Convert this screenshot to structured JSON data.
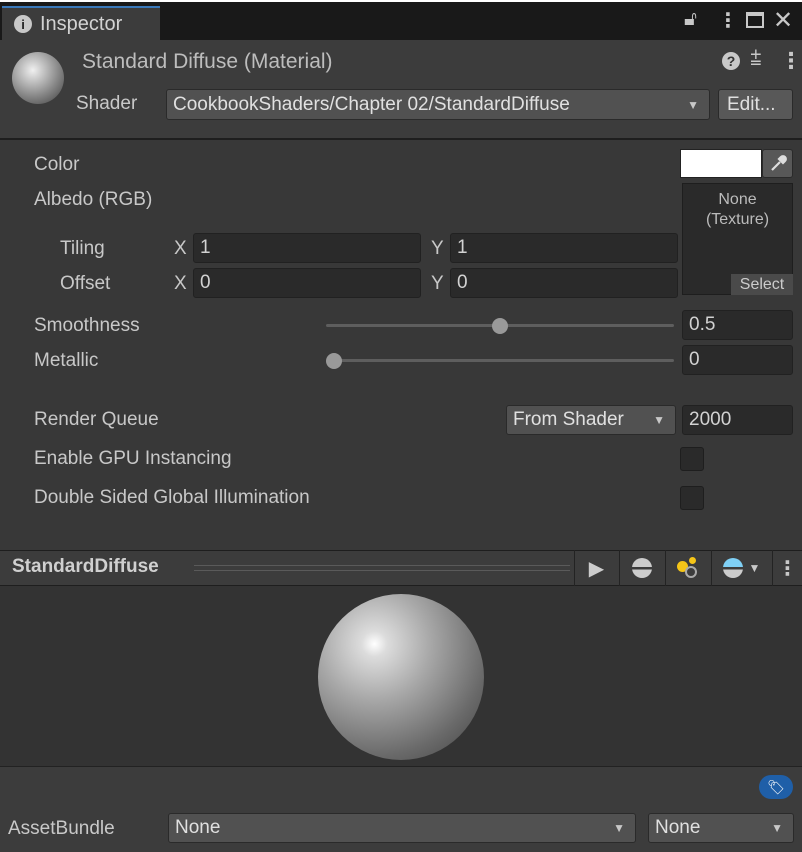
{
  "window": {
    "tab_label": "Inspector"
  },
  "header": {
    "title": "Standard Diffuse (Material)",
    "shader_label": "Shader",
    "shader_value": "CookbookShaders/Chapter 02/StandardDiffuse",
    "edit_label": "Edit..."
  },
  "properties": {
    "color_label": "Color",
    "color_value": "#ffffff",
    "albedo_label": "Albedo (RGB)",
    "texture_none": "None",
    "texture_type": "(Texture)",
    "select_label": "Select",
    "tiling_label": "Tiling",
    "offset_label": "Offset",
    "x_label": "X",
    "y_label": "Y",
    "tiling_x": "1",
    "tiling_y": "1",
    "offset_x": "0",
    "offset_y": "0",
    "smoothness_label": "Smoothness",
    "smoothness_value": "0.5",
    "smoothness": 0.5,
    "metallic_label": "Metallic",
    "metallic_value": "0",
    "metallic": 0,
    "render_queue_label": "Render Queue",
    "render_queue_mode": "From Shader",
    "render_queue_value": "2000",
    "gpu_instancing_label": "Enable GPU Instancing",
    "gpu_instancing": false,
    "double_sided_gi_label": "Double Sided Global Illumination",
    "double_sided_gi": false
  },
  "preview": {
    "title": "StandardDiffuse"
  },
  "asset_bundle": {
    "label": "AssetBundle",
    "name": "None",
    "variant": "None"
  },
  "colors": {
    "accent": "#3a79bb",
    "tag": "#1f5fa8",
    "light_yellow": "#f5c518",
    "sky_blue": "#7fd0f5"
  }
}
